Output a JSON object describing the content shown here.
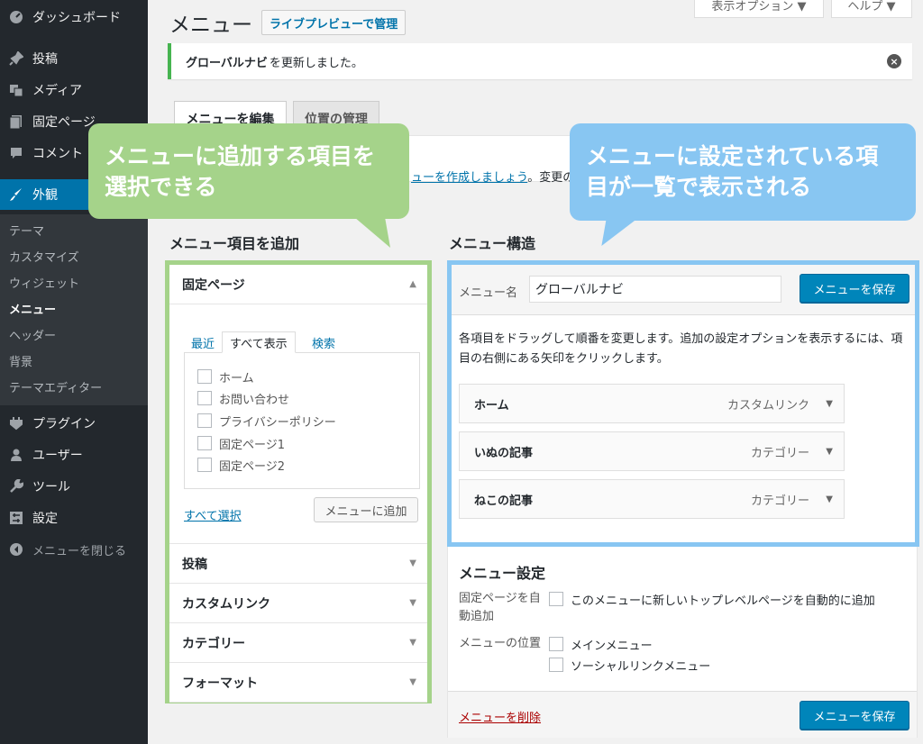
{
  "sidebar": {
    "dashboard": "ダッシュボード",
    "posts": "投稿",
    "media": "メディア",
    "pages": "固定ページ",
    "comments": "コメント",
    "appearance": "外観",
    "sub": [
      "テーマ",
      "カスタマイズ",
      "ウィジェット",
      "メニュー",
      "ヘッダー",
      "背景",
      "テーマエディター"
    ],
    "plugins": "プラグイン",
    "users": "ユーザー",
    "tools": "ツール",
    "settings": "設定",
    "collapse": "メニューを閉じる"
  },
  "header": {
    "title": "メニュー",
    "live_preview": "ライブプレビューで管理",
    "screen_options": "表示オプション ▼",
    "help": "ヘルプ ▼"
  },
  "notice": {
    "bold": "グローバルナビ",
    "text": "を更新しました。"
  },
  "tabs": {
    "edit": "メニューを編集",
    "locations": "位置の管理"
  },
  "manage_text": {
    "link": "ューを作成しましょう",
    "rest": "。変更の"
  },
  "callouts": {
    "green": "メニューに追加する項目を選択できる",
    "blue": "メニューに設定されている項目が一覧で表示される"
  },
  "add_items": {
    "heading": "メニュー項目を追加",
    "pages_title": "固定ページ",
    "subtabs": [
      "最近",
      "すべて表示",
      "検索"
    ],
    "pages": [
      "ホーム",
      "お問い合わせ",
      "プライバシーポリシー",
      "固定ページ1",
      "固定ページ2"
    ],
    "select_all": "すべて選択",
    "add_button": "メニューに追加",
    "sections": [
      "投稿",
      "カスタムリンク",
      "カテゴリー",
      "フォーマット"
    ]
  },
  "structure": {
    "heading": "メニュー構造",
    "name_label": "メニュー名",
    "name_value": "グローバルナビ",
    "save": "メニューを保存",
    "instructions": "各項目をドラッグして順番を変更します。追加の設定オプションを表示するには、項目の右側にある矢印をクリックします。",
    "items": [
      {
        "title": "ホーム",
        "type": "カスタムリンク"
      },
      {
        "title": "いぬの記事",
        "type": "カテゴリー"
      },
      {
        "title": "ねこの記事",
        "type": "カテゴリー"
      }
    ]
  },
  "settings": {
    "heading": "メニュー設定",
    "auto_add_label": "固定ページを自動追加",
    "auto_add_option": "このメニューに新しいトップレベルページを自動的に追加",
    "location_label": "メニューの位置",
    "locations": [
      "メインメニュー",
      "ソーシャルリンクメニュー"
    ],
    "delete": "メニューを削除",
    "save": "メニューを保存"
  },
  "colors": {
    "sidebar_bg": "#23282d",
    "accent": "#0073aa",
    "primary_button": "#0085ba",
    "green_highlight": "#a5d38a",
    "blue_highlight": "#88c6f2",
    "notice_success": "#46b450"
  },
  "icons": [
    "dashboard-icon",
    "pin-icon",
    "media-icon",
    "page-icon",
    "comment-icon",
    "brush-icon",
    "plugin-icon",
    "user-icon",
    "wrench-icon",
    "settings-icon",
    "collapse-icon",
    "close-icon",
    "triangle-icon"
  ]
}
